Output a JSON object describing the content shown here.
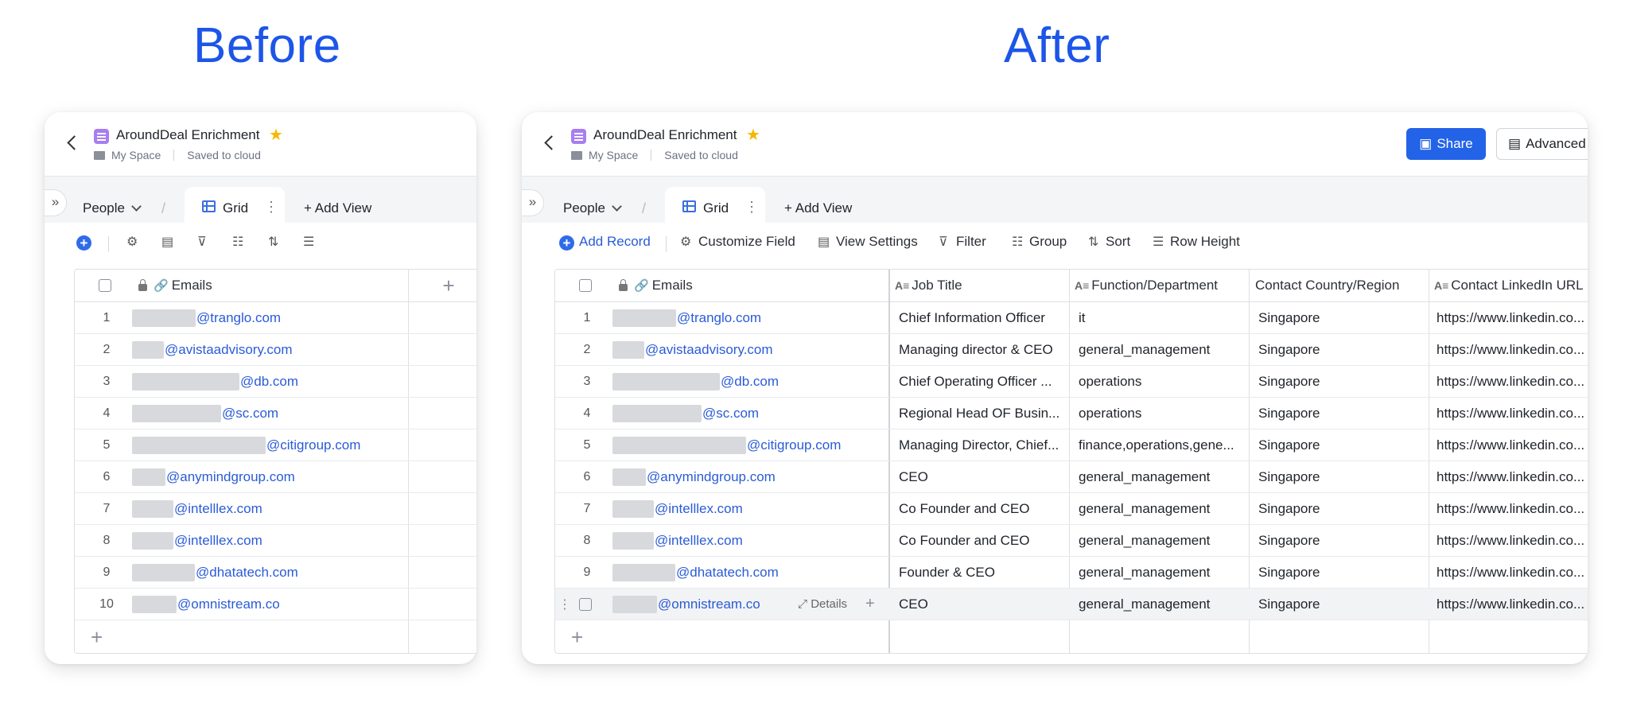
{
  "headings": {
    "before": "Before",
    "after": "After"
  },
  "app": {
    "title": "AroundDeal Enrichment",
    "location": "My Space",
    "save_status": "Saved to cloud",
    "expand_glyph": "»",
    "table_selector": "People",
    "view_tab": "Grid",
    "add_view": "Add View",
    "share": "Share",
    "advanced": "Advanced"
  },
  "toolbar": {
    "add_record": "Add Record",
    "customize_field": "Customize Field",
    "view_settings": "View Settings",
    "filter": "Filter",
    "group": "Group",
    "sort": "Sort",
    "row_height": "Row Height"
  },
  "columns": {
    "emails": "Emails",
    "job_title": "Job Title",
    "function": "Function/Department",
    "country": "Contact Country/Region",
    "linkedin": "Contact LinkedIn URL"
  },
  "hover_row": {
    "details": "Details"
  },
  "rows": [
    {
      "num": "1",
      "domain": "@tranglo.com",
      "title": "Chief Information Officer",
      "func": "it",
      "country": "Singapore",
      "url": "https://www.linkedin.co..."
    },
    {
      "num": "2",
      "domain": "@avistaadvisory.com",
      "title": "Managing director & CEO",
      "func": "general_management",
      "country": "Singapore",
      "url": "https://www.linkedin.co..."
    },
    {
      "num": "3",
      "domain": "@db.com",
      "title": "Chief Operating Officer ...",
      "func": "operations",
      "country": "Singapore",
      "url": "https://www.linkedin.co..."
    },
    {
      "num": "4",
      "domain": "@sc.com",
      "title": "Regional Head OF Busin...",
      "func": "operations",
      "country": "Singapore",
      "url": "https://www.linkedin.co..."
    },
    {
      "num": "5",
      "domain": "@citigroup.com",
      "title": "Managing Director, Chief...",
      "func": "finance,operations,gene...",
      "country": "Singapore",
      "url": "https://www.linkedin.co..."
    },
    {
      "num": "6",
      "domain": "@anymindgroup.com",
      "title": "CEO",
      "func": "general_management",
      "country": "Singapore",
      "url": "https://www.linkedin.co..."
    },
    {
      "num": "7",
      "domain": "@intelllex.com",
      "title": "Co Founder and CEO",
      "func": "general_management",
      "country": "Singapore",
      "url": "https://www.linkedin.co..."
    },
    {
      "num": "8",
      "domain": "@intelllex.com",
      "title": "Co Founder and CEO",
      "func": "general_management",
      "country": "Singapore",
      "url": "https://www.linkedin.co..."
    },
    {
      "num": "9",
      "domain": "@dhatatech.com",
      "title": "Founder & CEO",
      "func": "general_management",
      "country": "Singapore",
      "url": "https://www.linkedin.co..."
    },
    {
      "num": "10",
      "domain": "@omnistream.co",
      "title": "CEO",
      "func": "general_management",
      "country": "Singapore",
      "url": "https://www.linkedin.co..."
    }
  ],
  "colors": {
    "accent": "#1d55e8",
    "link": "#2a5bd7",
    "button": "#2363e8",
    "doc_icon": "#a77ef0",
    "star": "#f5b700"
  }
}
